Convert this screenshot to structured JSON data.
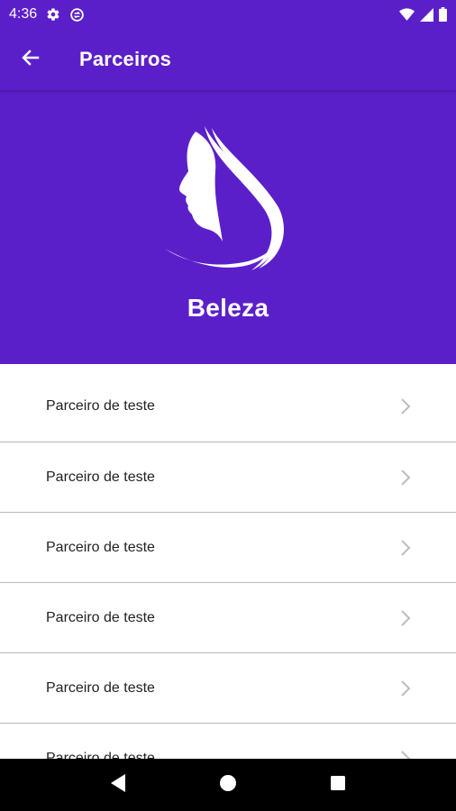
{
  "status_bar": {
    "time": "4:36",
    "icons": [
      "gear-icon",
      "sync-icon",
      "wifi-icon",
      "signal-icon",
      "battery-icon"
    ]
  },
  "app_bar": {
    "title": "Parceiros",
    "back_icon": "arrow-back-icon"
  },
  "hero": {
    "logo_icon": "woman-profile-icon",
    "category_title": "Beleza"
  },
  "partners": [
    {
      "label": "Parceiro de teste"
    },
    {
      "label": "Parceiro de teste"
    },
    {
      "label": "Parceiro de teste"
    },
    {
      "label": "Parceiro de teste"
    },
    {
      "label": "Parceiro de teste"
    },
    {
      "label": "Parceiro de teste"
    }
  ],
  "nav_bar": {
    "icons": [
      "back-triangle-icon",
      "home-circle-icon",
      "recents-square-icon"
    ]
  },
  "colors": {
    "primary": "#5b1fca",
    "divider": "#b8b8b8",
    "chevron": "#bdbdbd"
  }
}
